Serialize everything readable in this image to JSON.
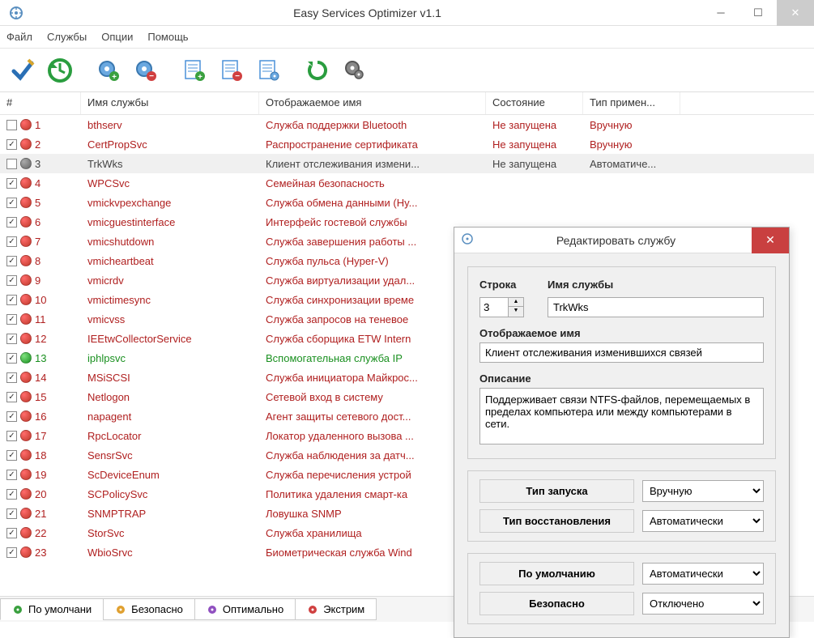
{
  "window": {
    "title": "Easy Services Optimizer v1.1"
  },
  "menu": {
    "file": "Файл",
    "services": "Службы",
    "options": "Опции",
    "help": "Помощь"
  },
  "columns": {
    "num": "#",
    "name": "Имя службы",
    "display": "Отображаемое имя",
    "state": "Состояние",
    "type": "Тип примен..."
  },
  "rows": [
    {
      "n": "1",
      "chk": false,
      "dot": "red",
      "cls": "red",
      "name": "bthserv",
      "disp": "Служба поддержки Bluetooth",
      "state": "Не запущена",
      "type": "Вручную"
    },
    {
      "n": "2",
      "chk": true,
      "dot": "red",
      "cls": "red",
      "name": "CertPropSvc",
      "disp": "Распространение сертификата",
      "state": "Не запущена",
      "type": "Вручную"
    },
    {
      "n": "3",
      "chk": false,
      "dot": "gray",
      "cls": "sel",
      "name": "TrkWks",
      "disp": "Клиент отслеживания измени...",
      "state": "Не запущена",
      "type": "Автоматиче..."
    },
    {
      "n": "4",
      "chk": true,
      "dot": "red",
      "cls": "red",
      "name": "WPCSvc",
      "disp": "Семейная безопасность",
      "state": "",
      "type": ""
    },
    {
      "n": "5",
      "chk": true,
      "dot": "red",
      "cls": "red",
      "name": "vmickvpexchange",
      "disp": "Служба обмена данными (Hy...",
      "state": "",
      "type": ""
    },
    {
      "n": "6",
      "chk": true,
      "dot": "red",
      "cls": "red",
      "name": "vmicguestinterface",
      "disp": "Интерфейс гостевой службы",
      "state": "",
      "type": ""
    },
    {
      "n": "7",
      "chk": true,
      "dot": "red",
      "cls": "red",
      "name": "vmicshutdown",
      "disp": "Служба завершения работы ...",
      "state": "",
      "type": ""
    },
    {
      "n": "8",
      "chk": true,
      "dot": "red",
      "cls": "red",
      "name": "vmicheartbeat",
      "disp": "Служба пульса (Hyper-V)",
      "state": "",
      "type": ""
    },
    {
      "n": "9",
      "chk": true,
      "dot": "red",
      "cls": "red",
      "name": "vmicrdv",
      "disp": "Служба виртуализации удал...",
      "state": "",
      "type": ""
    },
    {
      "n": "10",
      "chk": true,
      "dot": "red",
      "cls": "red",
      "name": "vmictimesync",
      "disp": "Служба синхронизации време",
      "state": "",
      "type": ""
    },
    {
      "n": "11",
      "chk": true,
      "dot": "red",
      "cls": "red",
      "name": "vmicvss",
      "disp": "Служба запросов на теневое",
      "state": "",
      "type": ""
    },
    {
      "n": "12",
      "chk": true,
      "dot": "red",
      "cls": "red",
      "name": "IEEtwCollectorService",
      "disp": "Служба сборщика ETW Intern",
      "state": "",
      "type": ""
    },
    {
      "n": "13",
      "chk": true,
      "dot": "green",
      "cls": "green",
      "name": "iphlpsvc",
      "disp": "Вспомогательная служба IP",
      "state": "",
      "type": ""
    },
    {
      "n": "14",
      "chk": true,
      "dot": "red",
      "cls": "red",
      "name": "MSiSCSI",
      "disp": "Служба инициатора Майкрос...",
      "state": "",
      "type": ""
    },
    {
      "n": "15",
      "chk": true,
      "dot": "red",
      "cls": "red",
      "name": "Netlogon",
      "disp": "Сетевой вход в систему",
      "state": "",
      "type": ""
    },
    {
      "n": "16",
      "chk": true,
      "dot": "red",
      "cls": "red",
      "name": "napagent",
      "disp": "Агент защиты сетевого дост...",
      "state": "",
      "type": ""
    },
    {
      "n": "17",
      "chk": true,
      "dot": "red",
      "cls": "red",
      "name": "RpcLocator",
      "disp": "Локатор удаленного вызова ...",
      "state": "",
      "type": ""
    },
    {
      "n": "18",
      "chk": true,
      "dot": "red",
      "cls": "red",
      "name": "SensrSvc",
      "disp": "Служба наблюдения за датч...",
      "state": "",
      "type": ""
    },
    {
      "n": "19",
      "chk": true,
      "dot": "red",
      "cls": "red",
      "name": "ScDeviceEnum",
      "disp": "Служба перечисления устрой",
      "state": "",
      "type": ""
    },
    {
      "n": "20",
      "chk": true,
      "dot": "red",
      "cls": "red",
      "name": "SCPolicySvc",
      "disp": "Политика удаления смарт-ка",
      "state": "",
      "type": ""
    },
    {
      "n": "21",
      "chk": true,
      "dot": "red",
      "cls": "red",
      "name": "SNMPTRAP",
      "disp": "Ловушка SNMP",
      "state": "",
      "type": ""
    },
    {
      "n": "22",
      "chk": true,
      "dot": "red",
      "cls": "red",
      "name": "StorSvc",
      "disp": "Служба хранилища",
      "state": "",
      "type": ""
    },
    {
      "n": "23",
      "chk": true,
      "dot": "red",
      "cls": "red",
      "name": "WbioSrvc",
      "disp": "Биометрическая служба Wind",
      "state": "",
      "type": ""
    }
  ],
  "tabs": {
    "default": "По умолчани",
    "safe": "Безопасно",
    "optimal": "Оптимально",
    "extreme": "Экстрим"
  },
  "dialog": {
    "title": "Редактировать службу",
    "row_label": "Строка",
    "name_label": "Имя службы",
    "row_value": "3",
    "name_value": "TrkWks",
    "disp_label": "Отображаемое имя",
    "disp_value": "Клиент отслеживания изменившихся связей",
    "desc_label": "Описание",
    "desc_value": "Поддерживает связи NTFS-файлов, перемещаемых в пределах компьютера или между компьютерами в сети.",
    "startup_label": "Тип запуска",
    "startup_value": "Вручную",
    "recovery_label": "Тип восстановления",
    "recovery_value": "Автоматически",
    "default_label": "По умолчанию",
    "default_value": "Автоматически",
    "safe_label": "Безопасно",
    "safe_value": "Отключено"
  }
}
